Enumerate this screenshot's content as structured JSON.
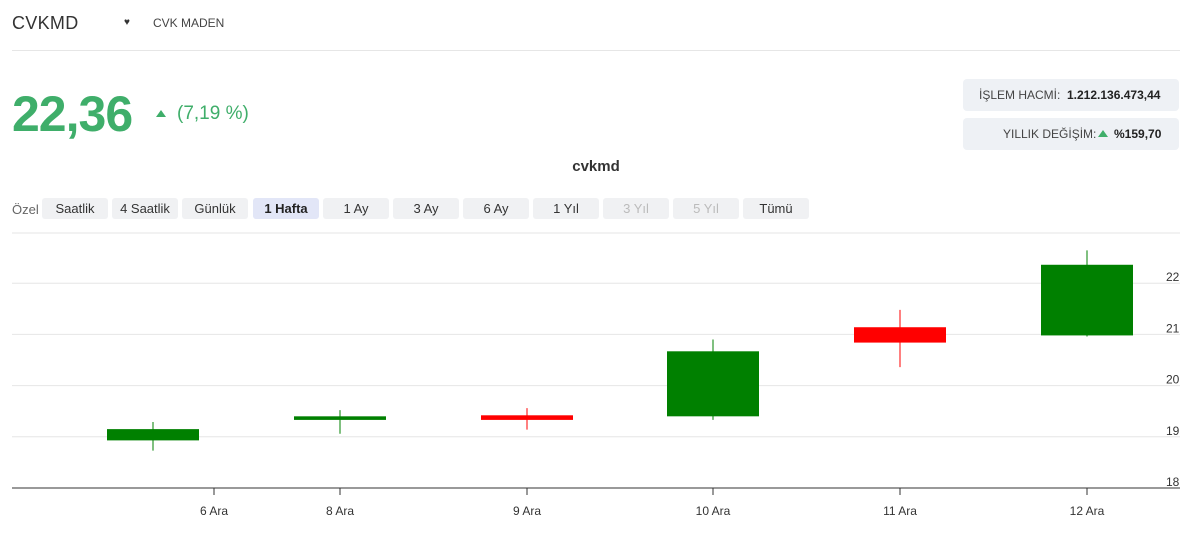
{
  "header": {
    "symbol": "CVKMD",
    "company": "CVK MADEN",
    "caret_icon": "heart-icon"
  },
  "quote": {
    "price": "22,36",
    "change": "(7,19 %)",
    "direction": "up",
    "color": "#3fae6a"
  },
  "stats": {
    "volume_label": "İŞLEM HACMİ:",
    "volume_value": "1.212.136.473,44",
    "yearly_label": "YILLIK DEĞİŞİM:",
    "yearly_value": "%159,70"
  },
  "range_selector": {
    "label": "Özel",
    "options": [
      {
        "label": "Saatlik",
        "state": "normal"
      },
      {
        "label": "4 Saatlik",
        "state": "normal"
      },
      {
        "label": "Günlük",
        "state": "normal"
      },
      {
        "label": "1 Hafta",
        "state": "active"
      },
      {
        "label": "1 Ay",
        "state": "normal"
      },
      {
        "label": "3 Ay",
        "state": "normal"
      },
      {
        "label": "6 Ay",
        "state": "normal"
      },
      {
        "label": "1 Yıl",
        "state": "normal"
      },
      {
        "label": "3 Yıl",
        "state": "disabled"
      },
      {
        "label": "5 Yıl",
        "state": "disabled"
      },
      {
        "label": "Tümü",
        "state": "normal"
      }
    ]
  },
  "chart_data": {
    "type": "candlestick",
    "title": "cvkmd",
    "x_tick_labels": [
      "6 Ara",
      "8 Ara",
      "9 Ara",
      "10 Ara",
      "11 Ara",
      "12 Ara"
    ],
    "ylim": [
      18,
      23
    ],
    "y_ticks": [
      18,
      19,
      20,
      21,
      22
    ],
    "grid": true,
    "up_color": "#008000",
    "down_color": "#ff0000",
    "candles": [
      {
        "open": 18.93,
        "high": 19.29,
        "low": 18.73,
        "close": 19.15,
        "direction": "up"
      },
      {
        "open": 19.33,
        "high": 19.52,
        "low": 19.06,
        "close": 19.4,
        "direction": "up"
      },
      {
        "open": 19.42,
        "high": 19.56,
        "low": 19.14,
        "close": 19.33,
        "direction": "down"
      },
      {
        "open": 19.4,
        "high": 20.9,
        "low": 19.33,
        "close": 20.67,
        "direction": "up"
      },
      {
        "open": 21.14,
        "high": 21.48,
        "low": 20.36,
        "close": 20.84,
        "direction": "down"
      },
      {
        "open": 20.98,
        "high": 22.64,
        "low": 20.96,
        "close": 22.36,
        "direction": "up"
      }
    ]
  }
}
